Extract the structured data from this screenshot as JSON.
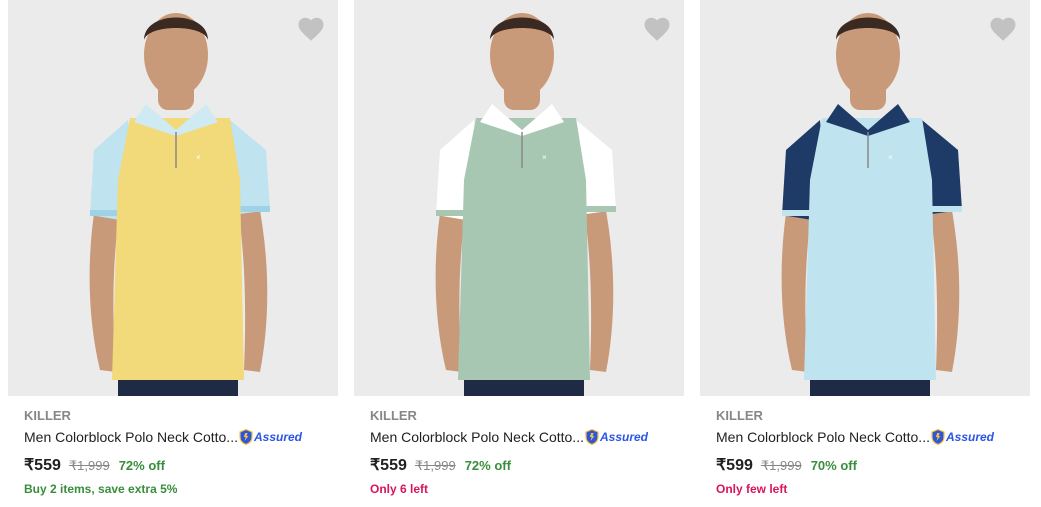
{
  "colors": {
    "assured_blue": "#2a55e5",
    "offer_green": "#388e3c",
    "stock_pink": "#d8145e",
    "mrp_gray": "#878787"
  },
  "products": [
    {
      "brand": "KILLER",
      "title": "Men Colorblock Polo Neck Cotto...",
      "assured": "Assured",
      "price": "₹559",
      "mrp": "₹1,999",
      "discount": "72% off",
      "extra": "Buy 2 items, save extra 5%",
      "extra_color": "#388e3c",
      "shirt": {
        "body": "#f2d97a",
        "sleeve": "#bfe3ef",
        "collar": "#cfeaf2",
        "trim": "#9ed2e4"
      },
      "icon": "heart-icon"
    },
    {
      "brand": "KILLER",
      "title": "Men Colorblock Polo Neck Cotto...",
      "assured": "Assured",
      "price": "₹559",
      "mrp": "₹1,999",
      "discount": "72% off",
      "extra": "Only 6 left",
      "extra_color": "#d8145e",
      "shirt": {
        "body": "#a8c7b2",
        "sleeve": "#ffffff",
        "collar": "#ffffff",
        "trim": "#a8c7b2"
      },
      "icon": "heart-icon"
    },
    {
      "brand": "KILLER",
      "title": "Men Colorblock Polo Neck Cotto...",
      "assured": "Assured",
      "price": "₹599",
      "mrp": "₹1,999",
      "discount": "70% off",
      "extra": "Only few left",
      "extra_color": "#d8145e",
      "shirt": {
        "body": "#bfe4ef",
        "sleeve": "#1e3a66",
        "collar": "#1e3a66",
        "trim": "#bfe4ef"
      },
      "icon": "heart-icon"
    }
  ]
}
